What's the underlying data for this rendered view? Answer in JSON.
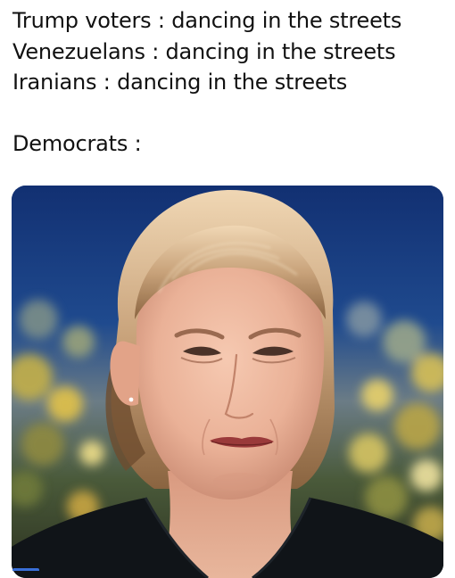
{
  "caption": {
    "line1": "Trump voters : dancing in the streets",
    "line2": "Venezuelans : dancing in the streets",
    "line3": "Iranians : dancing in the streets",
    "line4": "Democrats :"
  },
  "photo": {
    "icon": "woman-frowning-photo"
  }
}
